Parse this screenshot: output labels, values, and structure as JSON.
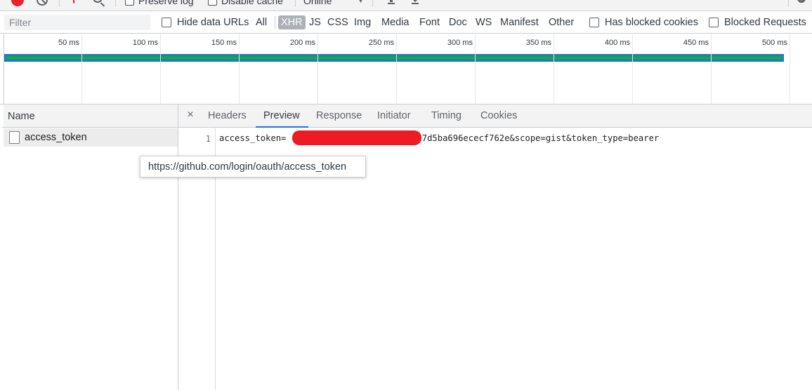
{
  "toolbar": {
    "preserve_log_label": "Preserve log",
    "disable_cache_label": "Disable cache",
    "throttling_value": "Online"
  },
  "filter_bar": {
    "filter_placeholder": "Filter",
    "hide_data_urls_label": "Hide data URLs",
    "type_filters": [
      "All",
      "XHR",
      "JS",
      "CSS",
      "Img",
      "Media",
      "Font",
      "Doc",
      "WS",
      "Manifest",
      "Other"
    ],
    "active_type": "XHR",
    "has_blocked_cookies_label": "Has blocked cookies",
    "blocked_requests_label": "Blocked Requests"
  },
  "overview": {
    "tick_labels": [
      "50 ms",
      "100 ms",
      "150 ms",
      "200 ms",
      "250 ms",
      "300 ms",
      "350 ms",
      "400 ms",
      "450 ms",
      "500 ms"
    ],
    "colors": {
      "bar_fill": "#1e9a43",
      "bar_border": "#1a73e8"
    }
  },
  "name_panel": {
    "header": "Name",
    "requests": [
      {
        "name": "access_token"
      }
    ]
  },
  "tooltip": {
    "text": "https://github.com/login/oauth/access_token"
  },
  "details": {
    "close_label": "×",
    "tabs": [
      "Headers",
      "Preview",
      "Response",
      "Initiator",
      "Timing",
      "Cookies"
    ],
    "active_tab": "Preview",
    "preview": {
      "line_number": "1",
      "prefix": "access_token=",
      "suffix": "27d5ba696ececf762e&scope=gist&token_type=bearer"
    }
  },
  "colors": {
    "accent": "#1a73e8",
    "record": "#e8212c",
    "redaction": "#ed1c24",
    "active_type_bg": "#acb0b8"
  }
}
